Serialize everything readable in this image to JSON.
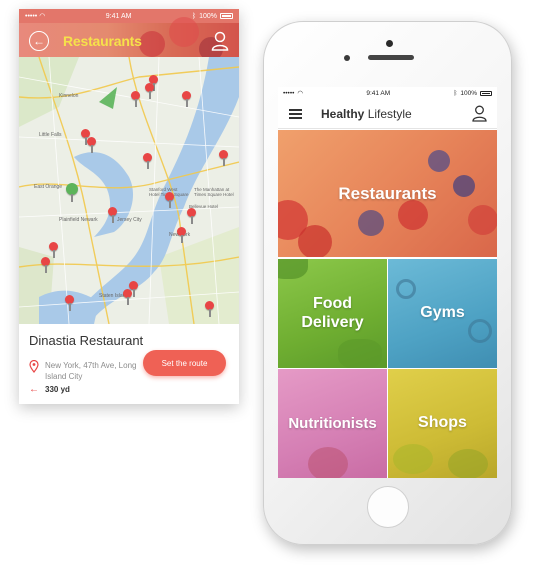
{
  "left_app": {
    "status": {
      "carrier_dots": "•••••",
      "time": "9:41 AM",
      "battery": "100%"
    },
    "header": {
      "title": "Restaurants",
      "back_icon": "arrow-left-icon",
      "user_icon": "user-icon"
    },
    "map": {
      "labels": [
        "Kinnelon",
        "Little Falls",
        "East Orange",
        "Plainfield Newark",
        "Staten Island",
        "Jersey City",
        "New York",
        "The Manhattan at Times Square Hotel",
        "Bellevue Hotel",
        "Stanford West Hotel Times Square"
      ]
    },
    "detail": {
      "name": "Dinastia Restaurant",
      "address": "New York, 47th Ave, Long Island City",
      "distance": "330 yd",
      "route_button": "Set the route"
    }
  },
  "right_app": {
    "status": {
      "carrier_dots": "•••••",
      "time": "9:41 AM",
      "battery": "100%"
    },
    "header": {
      "brand_bold": "Healthy",
      "brand_light": "Lifestyle",
      "menu_icon": "hamburger-icon",
      "user_icon": "user-icon"
    },
    "tiles": [
      {
        "label": "Restaurants",
        "color": "#e57a55"
      },
      {
        "label": "Food Delivery",
        "color": "#7dba3c"
      },
      {
        "label": "Gyms",
        "color": "#5aaed0"
      },
      {
        "label": "Nutritionists",
        "color": "#d884b8"
      },
      {
        "label": "Shops",
        "color": "#d6c43a"
      }
    ]
  }
}
